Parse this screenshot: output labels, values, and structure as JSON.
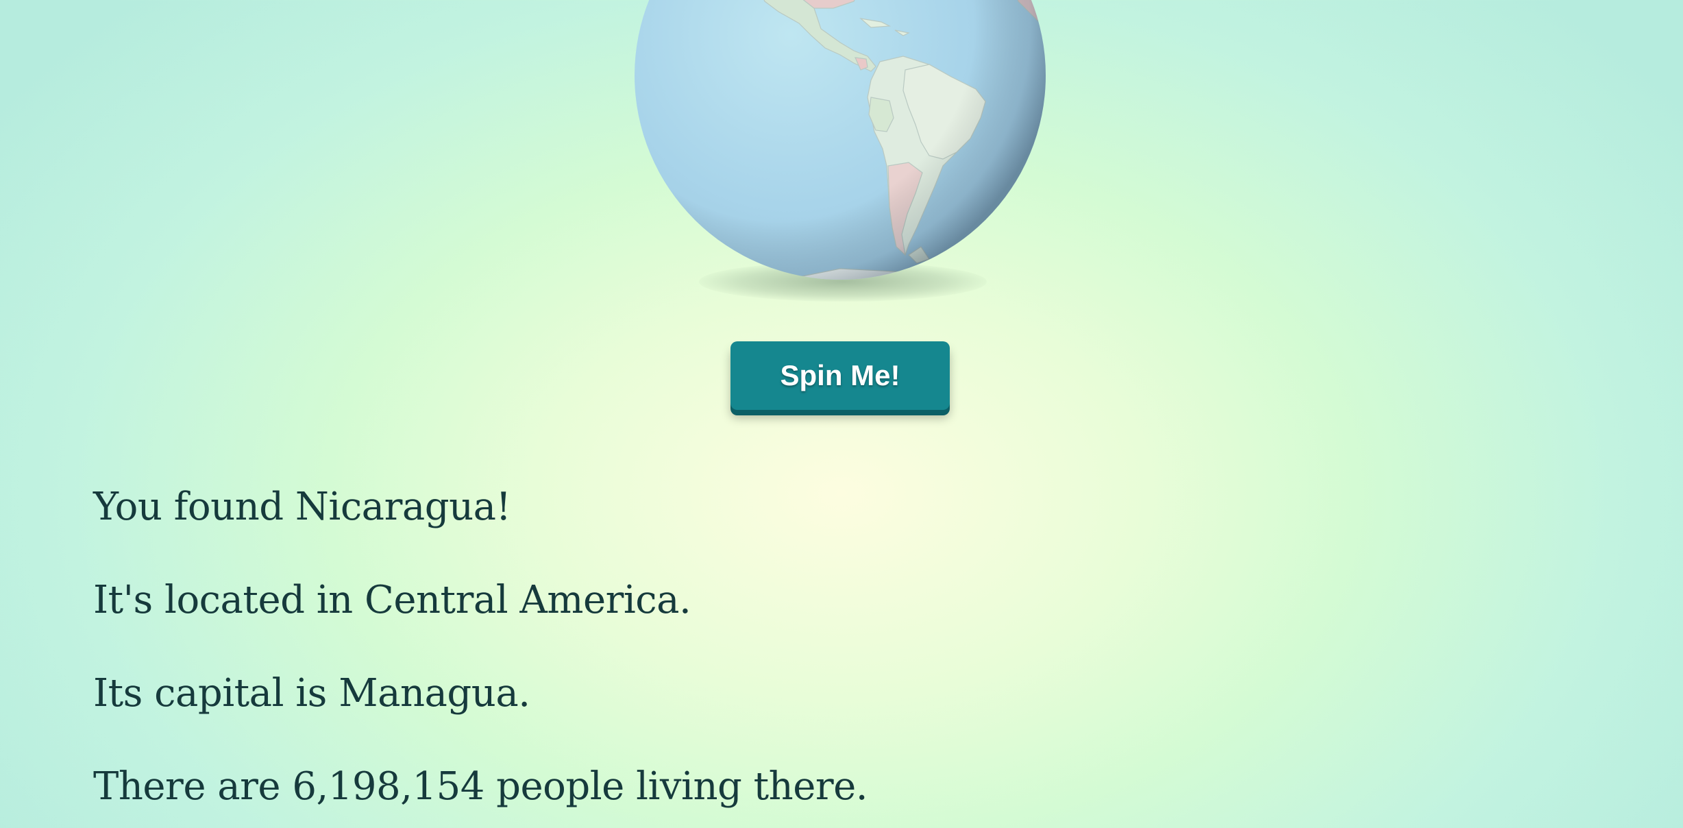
{
  "globe": {
    "icon": "globe-icon",
    "colors": {
      "ocean": "#a8d4ea",
      "land": "#e2efe0",
      "highlight_country": "#e9c9c8"
    }
  },
  "spin_button": {
    "label": "Spin Me!",
    "color": "#15878f"
  },
  "result": {
    "found": "You found Nicaragua!",
    "location": "It's located in Central America.",
    "capital": "Its capital is Managua.",
    "population": "There are 6,198,154 people living there."
  },
  "colors": {
    "text": "#163a3c",
    "background_center": "#fdfde0",
    "background_edge": "#b6ecde"
  }
}
